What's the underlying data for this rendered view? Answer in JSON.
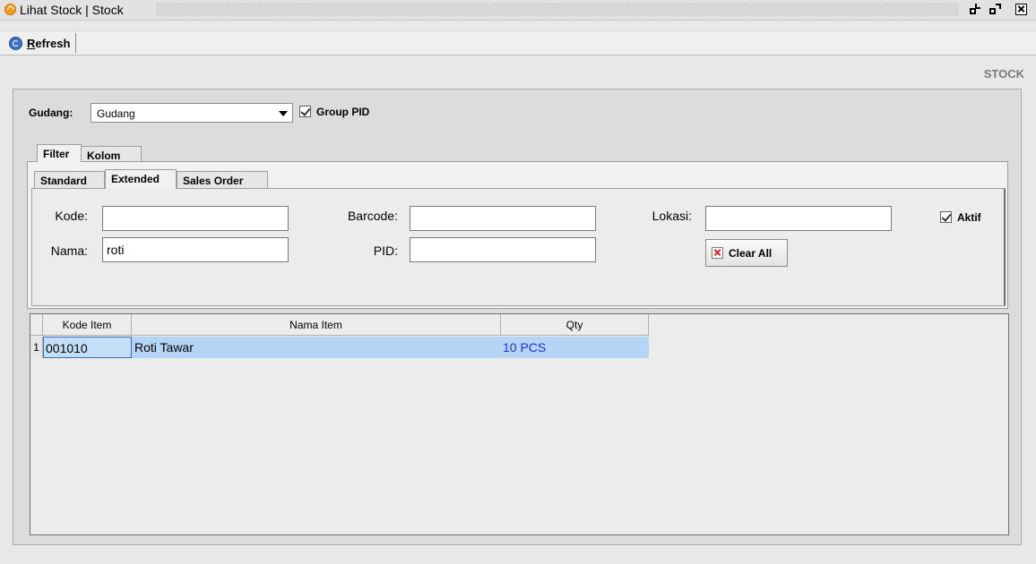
{
  "window": {
    "title": "Lihat Stock | Stock"
  },
  "toolbar": {
    "refresh_label": "Refresh"
  },
  "header": {
    "section_label": "STOCK"
  },
  "gudang": {
    "label": "Gudang:",
    "selected": "Gudang",
    "group_pid_label": "Group PID",
    "group_pid_checked": true
  },
  "tabs": [
    {
      "label": "Filter",
      "selected": true
    },
    {
      "label": "Kolom",
      "selected": false
    }
  ],
  "subtabs": [
    {
      "label": "Standard",
      "selected": false
    },
    {
      "label": "Extended",
      "selected": true
    },
    {
      "label": "Sales Order",
      "selected": false
    }
  ],
  "filters": {
    "kode": {
      "label": "Kode:",
      "value": ""
    },
    "nama": {
      "label": "Nama:",
      "value": "roti"
    },
    "barcode": {
      "label": "Barcode:",
      "value": ""
    },
    "pid": {
      "label": "PID:",
      "value": ""
    },
    "lokasi": {
      "label": "Lokasi:",
      "value": ""
    },
    "clear_all_label": "Clear All",
    "aktif_label": "Aktif",
    "aktif_checked": true
  },
  "table": {
    "columns": [
      "Kode Item",
      "Nama Item",
      "Qty"
    ],
    "rows": [
      {
        "num": "1",
        "kode": "001010",
        "nama": "Roti Tawar",
        "qty": "10 PCS"
      }
    ]
  },
  "colors": {
    "selected_row": "#b4d5f6",
    "qty_text": "#1d33d8"
  },
  "icons": [
    "app-icon",
    "refresh-icon",
    "clear-icon",
    "chevron-down-icon",
    "checkbox-icon"
  ]
}
